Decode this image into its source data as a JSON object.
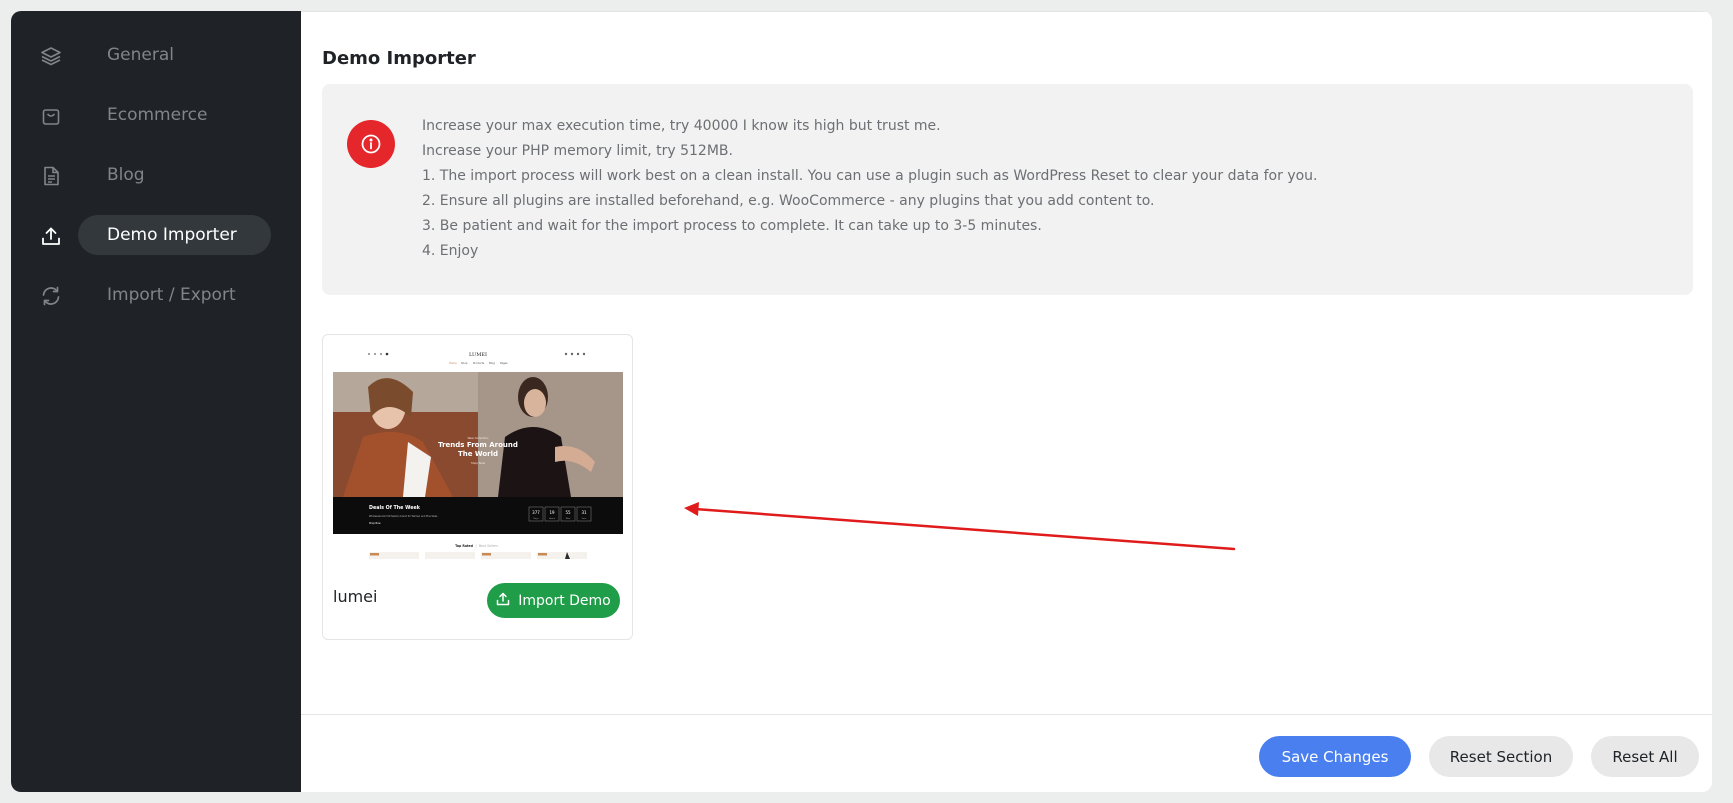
{
  "sidebar": {
    "items": [
      {
        "label": "General",
        "icon": "layers-icon"
      },
      {
        "label": "Ecommerce",
        "icon": "shopping-bag-icon"
      },
      {
        "label": "Blog",
        "icon": "document-icon"
      },
      {
        "label": "Demo Importer",
        "icon": "upload-icon",
        "active": true
      },
      {
        "label": "Import / Export",
        "icon": "refresh-icon"
      }
    ]
  },
  "main": {
    "title": "Demo Importer",
    "notice": {
      "icon": "info-icon",
      "lines": [
        "Increase your max execution time, try 40000 I know its high but trust me.",
        "Increase your PHP memory limit, try 512MB.",
        "1. The import process will work best on a clean install. You can use a plugin such as WordPress Reset to clear your data for you.",
        "2. Ensure all plugins are installed beforehand, e.g. WooCommerce - any plugins that you add content to.",
        "3. Be patient and wait for the import process to complete. It can take up to 3-5 minutes.",
        "4. Enjoy"
      ]
    },
    "demo": {
      "name": "lumei",
      "button_label": "Import Demo",
      "thumbnail": {
        "logo": "LUMEI",
        "nav": [
          "Home",
          "Shop",
          "Products",
          "Blog",
          "Pages"
        ],
        "hero_small": "New Collection",
        "hero_title_1": "Trends From Around",
        "hero_title_2": "The World",
        "hero_link": "Shop Now",
        "deals_title": "Deals Of The Week",
        "deals_text": "Wholesale bold UK fashion brand for Women and Plus Sizes",
        "deals_link": "Shop Now",
        "countdown": [
          {
            "value": "377",
            "unit": "Days"
          },
          {
            "value": "19",
            "unit": "Hours"
          },
          {
            "value": "55",
            "unit": "Mins"
          },
          {
            "value": "31",
            "unit": "Secs"
          }
        ],
        "tab_active": "Top Rated",
        "tab_inactive": "Best Sellers"
      }
    }
  },
  "footer": {
    "save": "Save Changes",
    "reset_section": "Reset Section",
    "reset_all": "Reset All"
  },
  "colors": {
    "sidebar_bg": "#1f2327",
    "active_pill": "#33383d",
    "notice_badge": "#e5262b",
    "import_button": "#1f9d48",
    "save_button": "#4a7ff0",
    "annotation_arrow": "#e01b1b"
  }
}
